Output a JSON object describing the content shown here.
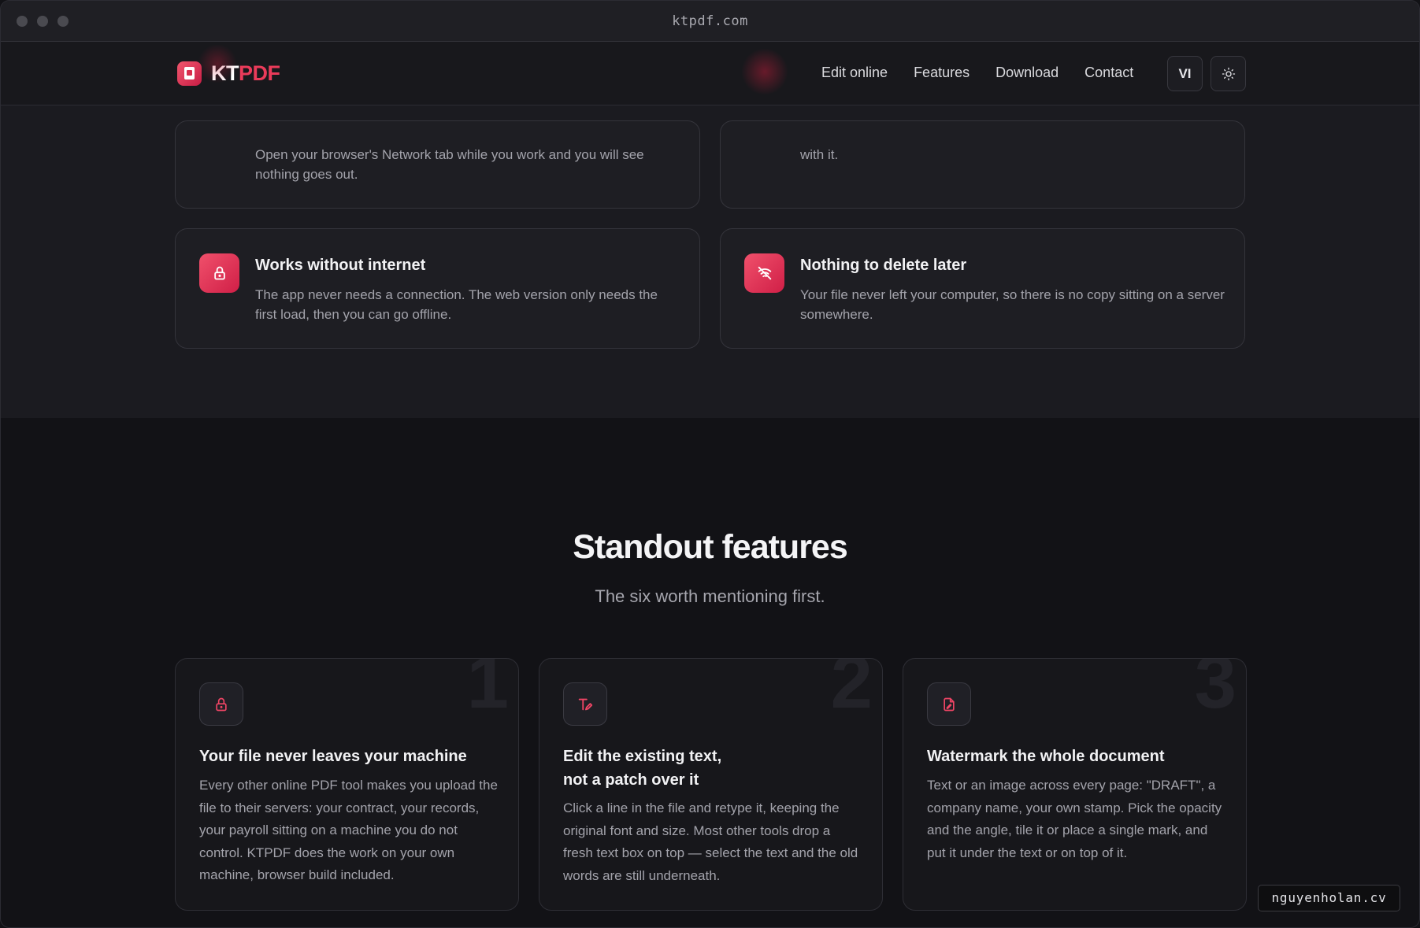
{
  "browser": {
    "url": "ktpdf.com"
  },
  "nav": {
    "brand_kt": "KT",
    "brand_pdf": "PDF",
    "links": [
      "Edit online",
      "Features",
      "Download",
      "Contact"
    ],
    "lang_button": "VI",
    "theme_icon": "sun-icon"
  },
  "privacy_cards": {
    "top_left_tail": "Open your browser's Network tab while you work and you will see nothing goes out.",
    "top_right_tail": "with it.",
    "offline": {
      "icon": "lock-icon",
      "title": "Works without internet",
      "desc": "The app never needs a connection. The web version only needs the first load, then you can go offline."
    },
    "no_delete": {
      "icon": "cloud-off-icon",
      "title": "Nothing to delete later",
      "desc": "Your file never left your computer, so there is no copy sitting on a server somewhere."
    }
  },
  "standout": {
    "title": "Standout features",
    "subtitle": "The six worth mentioning first.",
    "cards": [
      {
        "number": "1",
        "icon": "lock-icon",
        "title": "Your file never leaves your machine",
        "desc": "Every other online PDF tool makes you upload the file to their servers: your contract, your records, your payroll sitting on a machine you do not control. KTPDF does the work on your own machine, browser build included."
      },
      {
        "number": "2",
        "icon": "text-edit-icon",
        "title_line1": "Edit the existing text,",
        "title_line2": "not a patch over it",
        "desc": "Click a line in the file and retype it, keeping the original font and size. Most other tools drop a fresh text box on top — select the text and the old words are still underneath."
      },
      {
        "number": "3",
        "icon": "file-signature-icon",
        "title": "Watermark the whole document",
        "desc": "Text or an image across every page: \"DRAFT\", a company name, your own stamp. Pick the opacity and the angle, tile it or place a single mark, and put it under the text or on top of it."
      }
    ]
  },
  "watermark_badge": "nguyenholan.cv",
  "colors": {
    "accent": "#ea3b5a",
    "background": "#121216",
    "card": "#1e1e23"
  }
}
